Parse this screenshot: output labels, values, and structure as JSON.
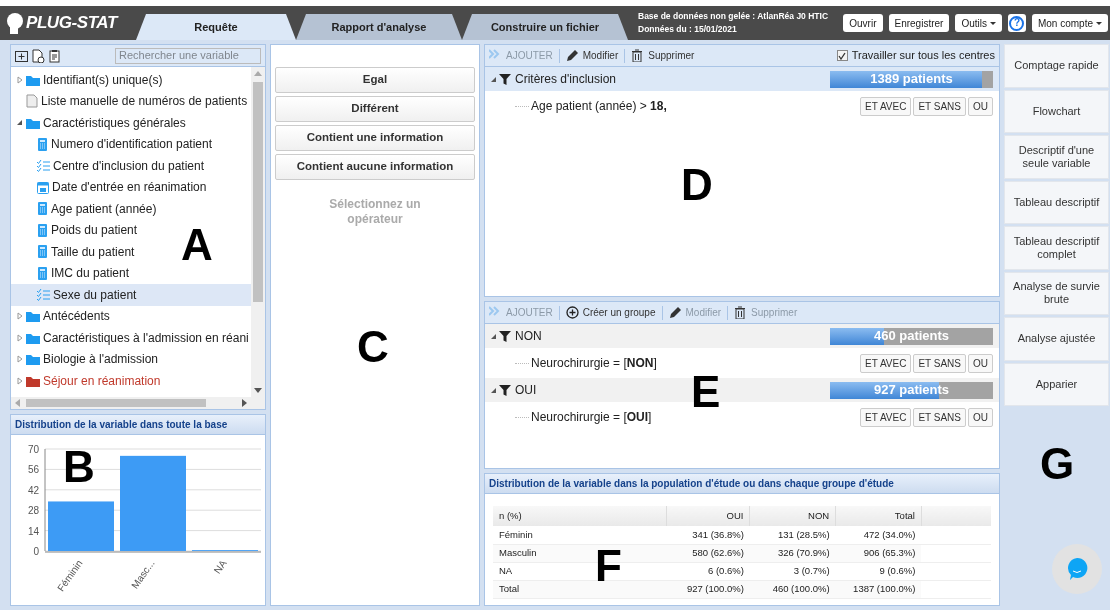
{
  "logo": "PLUG-STAT",
  "tabs": [
    {
      "label": "Requête",
      "selected": true
    },
    {
      "label": "Rapport d'analyse",
      "selected": false
    },
    {
      "label": "Construire un fichier",
      "selected": false
    }
  ],
  "db_info": [
    "Base de données non gelée : AtlanRéa J0 HTIC",
    "Données du : 15/01/2021"
  ],
  "header_buttons": [
    {
      "label": "Ouvrir",
      "kind": "plain"
    },
    {
      "label": "Enregistrer",
      "kind": "plain"
    },
    {
      "label": "Outils",
      "kind": "dropdown"
    },
    {
      "label": "?",
      "kind": "help"
    },
    {
      "label": "Mon compte",
      "kind": "dropdown"
    }
  ],
  "variables": {
    "callout": "A",
    "search": {
      "placeholder": "Rechercher une variable"
    },
    "tree": [
      {
        "label": "Identifiant(s) unique(s)",
        "kind": "folder",
        "expanded": false,
        "selected": false
      },
      {
        "label": "Liste manuelle de numéros de patients",
        "kind": "document",
        "selected": false
      },
      {
        "label": "Caractéristiques générales",
        "kind": "folder",
        "expanded": true,
        "selected": false,
        "children": [
          {
            "label": "Numero d'identification patient",
            "kind": "numeric",
            "selected": false
          },
          {
            "label": "Centre d'inclusion du patient",
            "kind": "list",
            "selected": false
          },
          {
            "label": "Date d'entrée en réanimation",
            "kind": "date",
            "selected": false
          },
          {
            "label": "Age patient (année)",
            "kind": "numeric",
            "selected": false
          },
          {
            "label": "Poids du patient",
            "kind": "numeric",
            "selected": false
          },
          {
            "label": "Taille du patient",
            "kind": "numeric",
            "selected": false
          },
          {
            "label": "IMC du patient",
            "kind": "numeric",
            "selected": false
          },
          {
            "label": "Sexe du patient",
            "kind": "list",
            "selected": true
          }
        ]
      },
      {
        "label": "Antécédents",
        "kind": "folder",
        "expanded": false,
        "selected": false
      },
      {
        "label": "Caractéristiques à l'admission en réani",
        "kind": "folder",
        "expanded": false,
        "selected": false
      },
      {
        "label": "Biologie à l'admission",
        "kind": "folder",
        "expanded": false,
        "selected": false
      },
      {
        "label": "Séjour en réanimation",
        "kind": "folder",
        "expanded": false,
        "selected": false,
        "color": "#c0392b"
      }
    ]
  },
  "distribution": {
    "title": "Distribution de la variable dans toute la base",
    "callout": "B",
    "chart_data": {
      "type": "bar",
      "categories": [
        "Féminin",
        "Masc...",
        "NA"
      ],
      "values": [
        34,
        65.3,
        0.6
      ],
      "grid": true,
      "ylim": [
        0,
        70
      ],
      "yticks": [
        0,
        14,
        28,
        42,
        56,
        70
      ]
    }
  },
  "operators": {
    "callout": "C",
    "buttons": [
      "Egal",
      "Différent",
      "Contient une information",
      "Contient aucune information"
    ],
    "hint": "Sélectionnez un opérateur"
  },
  "criteria": {
    "callout": "D",
    "toolbar": [
      {
        "label": "AJOUTER",
        "kind": "add",
        "disabled": true
      },
      {
        "label": "Modifier",
        "kind": "edit",
        "disabled": false
      },
      {
        "label": "Supprimer",
        "kind": "delete",
        "disabled": false
      }
    ],
    "all_centres": {
      "label": "Travailler sur tous les centres",
      "checked": true
    },
    "groups": [
      {
        "title": "Critères d'inclusion",
        "count": "1389 patients",
        "level": 0.93,
        "conditions": [
          {
            "text": "Age patient (année) > **18,**",
            "actions": [
              "ET AVEC",
              "ET SANS",
              "OU"
            ]
          }
        ]
      }
    ]
  },
  "study_groups": {
    "callout": "E",
    "toolbar": [
      {
        "label": "AJOUTER",
        "kind": "add",
        "disabled": true
      },
      {
        "label": "Créer un groupe",
        "kind": "create",
        "disabled": false
      },
      {
        "label": "Modifier",
        "kind": "edit",
        "disabled": true
      },
      {
        "label": "Supprimer",
        "kind": "delete",
        "disabled": true
      }
    ],
    "groups": [
      {
        "title": "NON",
        "count": "460 patients",
        "level": 0.33,
        "conditions": [
          {
            "text": "Neurochirurgie = [**NON**]",
            "actions": [
              "ET AVEC",
              "ET SANS",
              "OU"
            ]
          }
        ]
      },
      {
        "title": "OUI",
        "count": "927 patients",
        "level": 0.67,
        "conditions": [
          {
            "text": "Neurochirurgie = [**OUI**]",
            "actions": [
              "ET AVEC",
              "ET SANS",
              "OU"
            ]
          }
        ]
      }
    ]
  },
  "group_distribution": {
    "title": "Distribution de la variable dans la population d'étude ou dans chaque groupe d'étude",
    "callout": "F",
    "columns": [
      "n (%)",
      "OUI",
      "NON",
      "Total"
    ],
    "rows": [
      [
        "Féminin",
        "341 (36.8%)",
        "131 (28.5%)",
        "472 (34.0%)"
      ],
      [
        "Masculin",
        "580 (62.6%)",
        "326 (70.9%)",
        "906 (65.3%)"
      ],
      [
        "NA",
        "6 (0.6%)",
        "3 (0.7%)",
        "9 (0.6%)"
      ],
      [
        "Total",
        "927 (100.0%)",
        "460 (100.0%)",
        "1387 (100.0%)"
      ]
    ]
  },
  "analyses": {
    "callout": "G",
    "buttons": [
      "Comptage rapide",
      "Flowchart",
      "Descriptif d'une seule variable",
      "Tableau descriptif",
      "Tableau descriptif complet",
      "Analyse de survie brute",
      "Analyse ajustée",
      "Apparier"
    ]
  }
}
